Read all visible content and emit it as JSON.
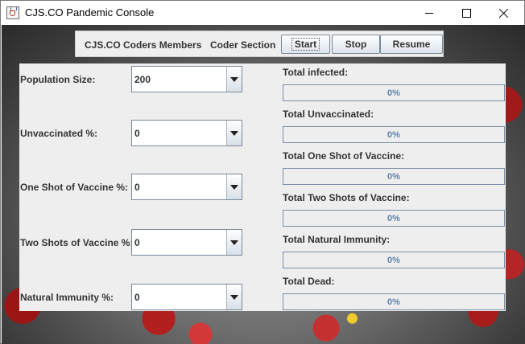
{
  "window": {
    "title": "CJS.CO Pandemic Console",
    "icon": "java-cup-icon"
  },
  "toolbar": {
    "members_label": "CJS.CO Coders Members",
    "section_label": "Coder Section",
    "start_label": "Start",
    "stop_label": "Stop",
    "resume_label": "Resume"
  },
  "inputs": [
    {
      "label": "Population Size:",
      "value": "200"
    },
    {
      "label": "Unvaccinated %:",
      "value": "0"
    },
    {
      "label": "One Shot of Vaccine %:",
      "value": "0"
    },
    {
      "label": "Two Shots of Vaccine %:",
      "value": "0"
    },
    {
      "label": "Natural Immunity %:",
      "value": "0"
    }
  ],
  "stats": [
    {
      "label": "Total infected:",
      "progress_text": "0%",
      "progress_fraction": 0
    },
    {
      "label": "Total Unvaccinated:",
      "progress_text": "0%",
      "progress_fraction": 0
    },
    {
      "label": "Total One Shot of Vaccine:",
      "progress_text": "0%",
      "progress_fraction": 0
    },
    {
      "label": "Total Two Shots of Vaccine:",
      "progress_text": "0%",
      "progress_fraction": 0
    },
    {
      "label": "Total Natural Immunity:",
      "progress_text": "0%",
      "progress_fraction": 0
    },
    {
      "label": "Total Dead:",
      "progress_text": "0%",
      "progress_fraction": 0
    }
  ],
  "colors": {
    "progress_text": "#5f82ad",
    "panel_background": "#eeeeee",
    "border": "#7a8a99"
  }
}
